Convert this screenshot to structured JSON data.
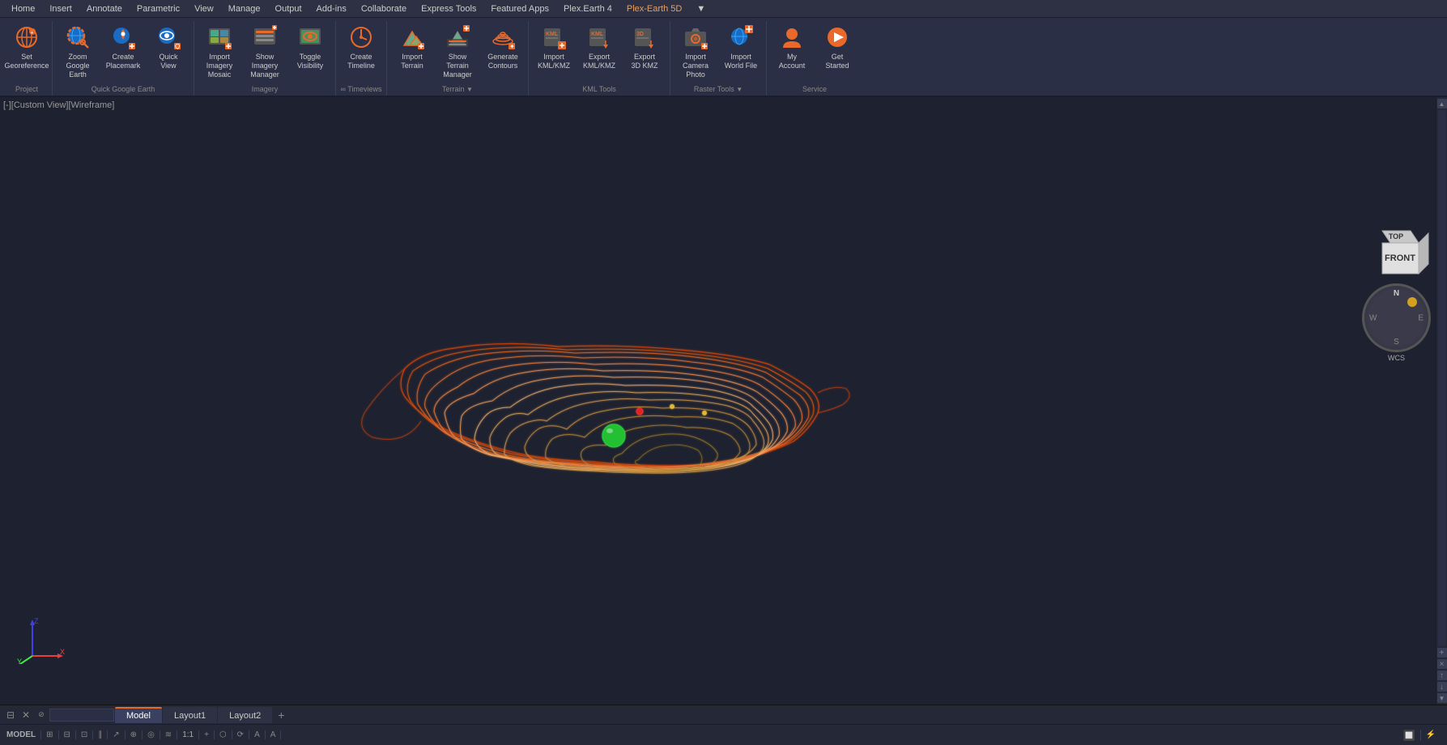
{
  "app": {
    "title": "Plex-Earth 5D",
    "viewport_label": "[-][Custom View][Wireframe]"
  },
  "menubar": {
    "items": [
      "Home",
      "Insert",
      "Annotate",
      "Parametric",
      "View",
      "Manage",
      "Output",
      "Add-ins",
      "Collaborate",
      "Express Tools",
      "Featured Apps",
      "Plex.Earth 4",
      "Plex-Earth 5D",
      "▼"
    ]
  },
  "ribbon": {
    "groups": [
      {
        "label": "Project",
        "buttons": [
          {
            "id": "set-georeference",
            "icon": "🌐",
            "label": "Set\nGeoreference",
            "orange": true
          }
        ]
      },
      {
        "label": "Quick Google Earth",
        "buttons": [
          {
            "id": "zoom-google-earth",
            "icon": "🔍",
            "label": "Zoom\nGoogle Earth",
            "orange": true
          },
          {
            "id": "create-placemark",
            "icon": "📍",
            "label": "Create\nPlacemark",
            "orange": true
          },
          {
            "id": "quick-view",
            "icon": "👁",
            "label": "Quick\nView",
            "orange": true
          }
        ]
      },
      {
        "label": "Imagery",
        "buttons": [
          {
            "id": "import-imagery-mosaic",
            "icon": "🗺",
            "label": "Import Imagery\nMosaic",
            "orange": true
          },
          {
            "id": "show-imagery-manager",
            "icon": "📋",
            "label": "Show Imagery\nManager",
            "orange": true
          },
          {
            "id": "toggle-visibility",
            "icon": "👁",
            "label": "Toggle\nVisibility",
            "orange": true
          }
        ]
      },
      {
        "label": "∞ Timeviews",
        "buttons": [
          {
            "id": "create-timeline",
            "icon": "⏱",
            "label": "Create\nTimeline",
            "orange": true
          }
        ]
      },
      {
        "label": "Terrain",
        "buttons": [
          {
            "id": "import-terrain",
            "icon": "⛰",
            "label": "Import\nTerrain",
            "orange": true
          },
          {
            "id": "show-terrain-manager",
            "icon": "📋",
            "label": "Show Terrain\nManager",
            "orange": true
          },
          {
            "id": "generate-contours",
            "icon": "〰",
            "label": "Generate\nContours",
            "orange": true
          }
        ]
      },
      {
        "label": "KML Tools",
        "buttons": [
          {
            "id": "import-kml-kmz",
            "icon": "📥",
            "label": "Import\nKML/KMZ",
            "orange": true
          },
          {
            "id": "export-kml-kmz",
            "icon": "📤",
            "label": "Export\nKML/KMZ",
            "orange": true
          },
          {
            "id": "export-3d-kmz",
            "icon": "📤",
            "label": "Export\n3D KMZ",
            "orange": true
          }
        ]
      },
      {
        "label": "Raster Tools",
        "buttons": [
          {
            "id": "import-camera-photo",
            "icon": "📷",
            "label": "Import\nCamera Photo",
            "orange": true
          },
          {
            "id": "import-world-file",
            "icon": "🌍",
            "label": "Import\nWorld File",
            "orange": true
          }
        ]
      },
      {
        "label": "Service",
        "buttons": [
          {
            "id": "my-account",
            "icon": "👤",
            "label": "My\nAccount",
            "orange": true
          },
          {
            "id": "get-started",
            "icon": "▶",
            "label": "Get\nStarted",
            "orange": true
          }
        ]
      }
    ]
  },
  "navcube": {
    "top_label": "TOP",
    "front_label": "FRONT",
    "wcs_label": "WCS"
  },
  "bottom_tabs": {
    "tabs": [
      "Model",
      "Layout1",
      "Layout2"
    ],
    "active": "Model"
  },
  "statusbar": {
    "model_label": "MODEL",
    "items": [
      "⊞",
      "⊟",
      "⊡",
      "∥",
      "↗",
      "⊕",
      "◎",
      "≋",
      "1:1",
      "+",
      "⬡",
      "⟳",
      "A",
      "A"
    ]
  },
  "axis": {
    "x_color": "#e84040",
    "y_color": "#40e840",
    "z_color": "#4040e8"
  }
}
